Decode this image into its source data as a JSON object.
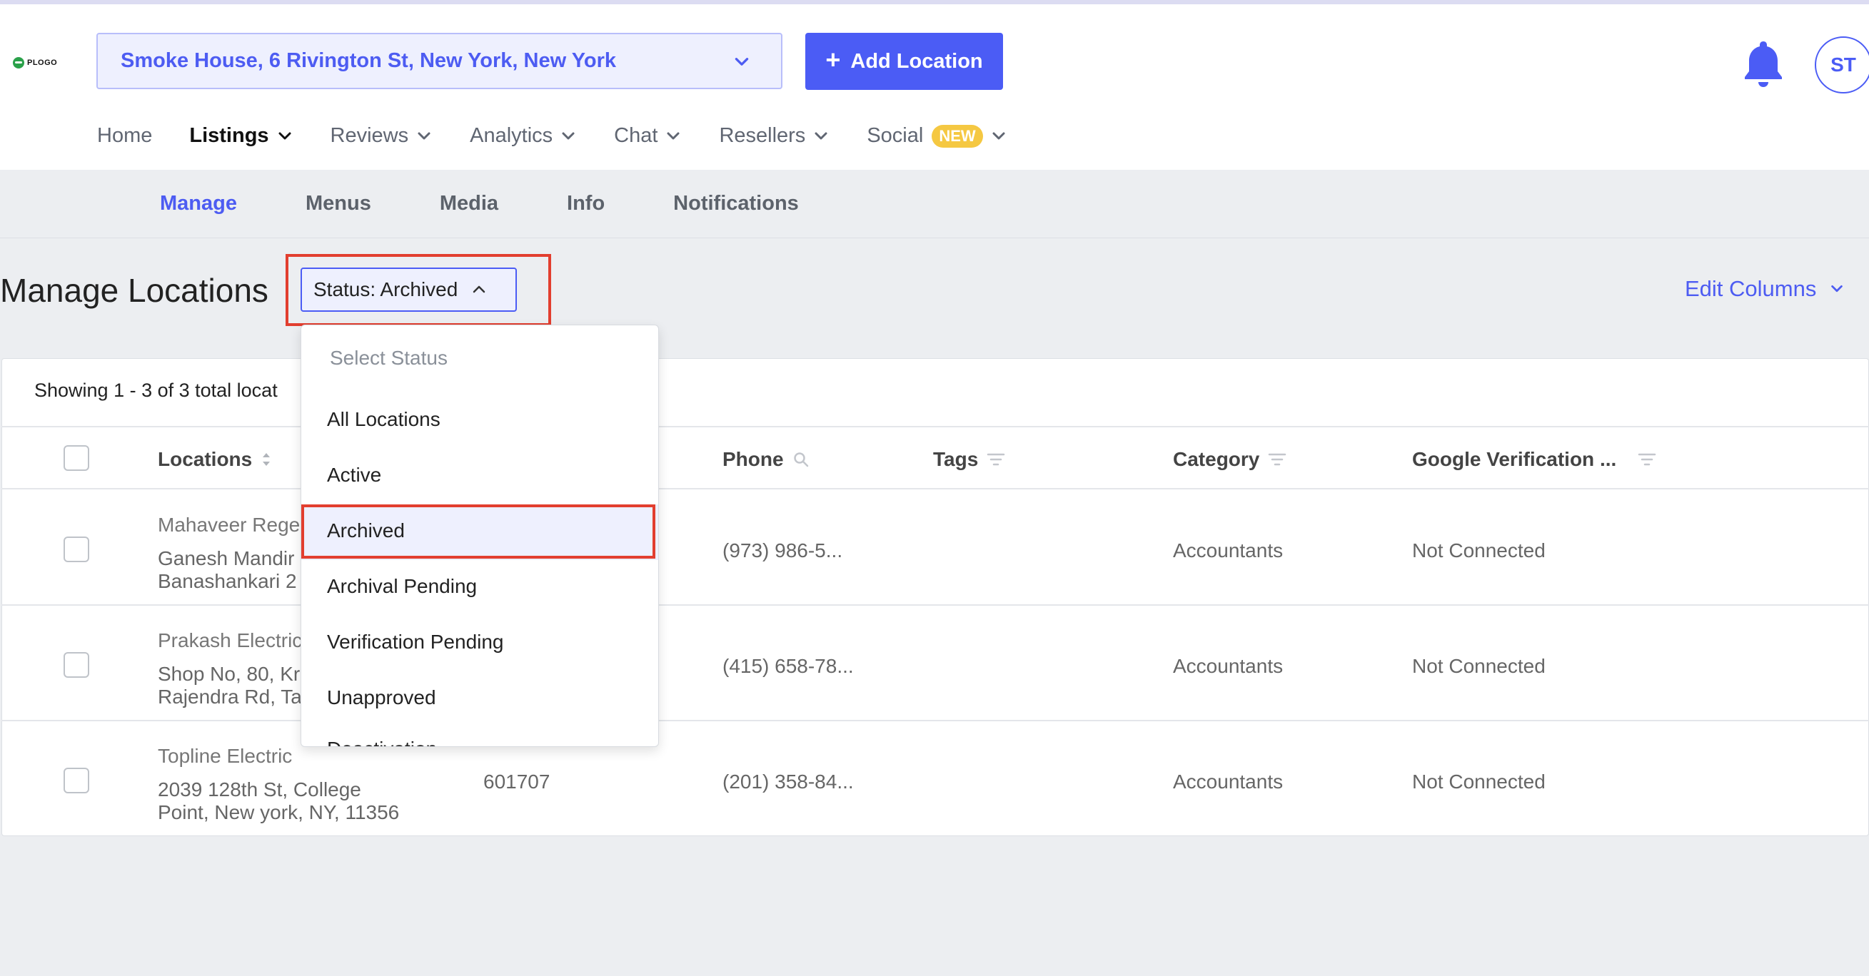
{
  "header": {
    "logo_text": "PLOGO",
    "location_select": "Smoke House, 6 Rivington St, New York, New York",
    "add_location_label": "Add Location",
    "avatar_initials": "ST"
  },
  "main_nav": {
    "items": [
      {
        "label": "Home",
        "active": false,
        "has_chevron": false
      },
      {
        "label": "Listings",
        "active": true,
        "has_chevron": true
      },
      {
        "label": "Reviews",
        "active": false,
        "has_chevron": true
      },
      {
        "label": "Analytics",
        "active": false,
        "has_chevron": true
      },
      {
        "label": "Chat",
        "active": false,
        "has_chevron": true
      },
      {
        "label": "Resellers",
        "active": false,
        "has_chevron": true
      },
      {
        "label": "Social",
        "active": false,
        "has_chevron": true,
        "badge": "NEW"
      }
    ]
  },
  "sub_nav": {
    "tabs": [
      {
        "label": "Manage",
        "active": true
      },
      {
        "label": "Menus",
        "active": false
      },
      {
        "label": "Media",
        "active": false
      },
      {
        "label": "Info",
        "active": false
      },
      {
        "label": "Notifications",
        "active": false
      }
    ]
  },
  "page": {
    "title": "Manage Locations",
    "status_filter": "Status: Archived",
    "edit_columns": "Edit Columns",
    "showing_text": "Showing 1 - 3 of 3 total locat"
  },
  "status_dropdown": {
    "placeholder": "Select Status",
    "options": [
      "All Locations",
      "Active",
      "Archived",
      "Archival Pending",
      "Verification Pending",
      "Unapproved",
      "Deactivation..."
    ],
    "selected": "Archived"
  },
  "table": {
    "columns": [
      "Locations",
      "Phone",
      "Tags",
      "Category",
      "Google Verification ..."
    ],
    "rows": [
      {
        "name": "Mahaveer Rege",
        "address_1": "Ganesh Mandir",
        "address_2": "Banashankari 2",
        "code": "",
        "phone": "(973) 986-5...",
        "tags": "",
        "category": "Accountants",
        "google": "Not Connected"
      },
      {
        "name": "Prakash Electric",
        "address_1": "Shop No, 80, Kr",
        "address_2": "Rajendra Rd, Ta",
        "code": "",
        "phone": "(415) 658-78...",
        "tags": "",
        "category": "Accountants",
        "google": "Not Connected"
      },
      {
        "name": "Topline Electric",
        "address_1": "2039 128th St, College",
        "address_2": "Point, New york, NY, 11356",
        "code": "601707",
        "phone": "(201) 358-84...",
        "tags": "",
        "category": "Accountants",
        "google": "Not Connected"
      }
    ]
  },
  "colors": {
    "accent": "#4b5cf5",
    "highlight": "#e23e2f",
    "badge": "#f5c842"
  }
}
